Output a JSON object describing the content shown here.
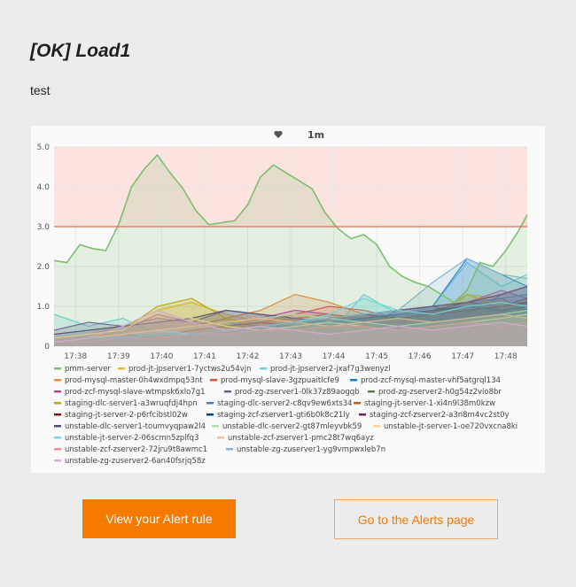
{
  "alert": {
    "title": "[OK] Load1",
    "message": "test"
  },
  "buttons": {
    "view_rule": "View your Alert rule",
    "alerts_page": "Go to the Alerts page"
  },
  "colors": {
    "accent": "#f47a00",
    "threshold": "#f06a50",
    "alert_region": "#fde3e0"
  },
  "chart_data": {
    "type": "area",
    "header_icon": "heart-icon",
    "interval": "1m",
    "threshold": 3.0,
    "ylim": [
      0,
      5.0
    ],
    "yticks": [
      "0",
      "1.0",
      "2.0",
      "3.0",
      "4.0",
      "5.0"
    ],
    "xlim": [
      "17:37:30",
      "17:48:30"
    ],
    "xticks": [
      "17:38",
      "17:39",
      "17:40",
      "17:41",
      "17:42",
      "17:43",
      "17:44",
      "17:45",
      "17:46",
      "17:47",
      "17:48"
    ],
    "grid": true,
    "legend_position": "bottom",
    "series": [
      {
        "name": "pmm-server",
        "color": "#7cbf6e",
        "x": [
          "17:37:30",
          "17:37:48",
          "17:38:06",
          "17:38:24",
          "17:38:42",
          "17:39:00",
          "17:39:18",
          "17:39:36",
          "17:39:54",
          "17:40:12",
          "17:40:30",
          "17:40:48",
          "17:41:06",
          "17:41:24",
          "17:41:42",
          "17:42:00",
          "17:42:18",
          "17:42:36",
          "17:42:54",
          "17:43:12",
          "17:43:30",
          "17:43:48",
          "17:44:06",
          "17:44:24",
          "17:44:42",
          "17:45:00",
          "17:45:18",
          "17:45:36",
          "17:45:54",
          "17:46:12",
          "17:46:30",
          "17:46:48",
          "17:47:06",
          "17:47:24",
          "17:47:42",
          "17:48:00",
          "17:48:18",
          "17:48:30"
        ],
        "values": [
          2.15,
          2.1,
          2.55,
          2.45,
          2.4,
          3.05,
          4.0,
          4.45,
          4.8,
          4.35,
          3.95,
          3.4,
          3.05,
          3.1,
          3.15,
          3.55,
          4.25,
          4.55,
          4.35,
          4.15,
          3.95,
          3.35,
          2.95,
          2.7,
          2.8,
          2.55,
          2.0,
          1.75,
          1.6,
          1.5,
          1.3,
          1.1,
          1.4,
          2.1,
          2.0,
          2.4,
          2.9,
          3.3
        ]
      },
      {
        "name": "prod-jt-jpserver1-7yctws2u54vjn",
        "color": "#f2b62c",
        "x": [
          "17:37:30",
          "17:38:18",
          "17:39:06",
          "17:39:54",
          "17:40:42",
          "17:41:30",
          "17:42:18",
          "17:43:06",
          "17:43:54",
          "17:44:42",
          "17:45:30",
          "17:46:18",
          "17:47:06",
          "17:47:54",
          "17:48:30"
        ],
        "values": [
          0.2,
          0.3,
          0.5,
          0.9,
          1.1,
          0.8,
          0.6,
          0.5,
          0.4,
          0.3,
          0.5,
          0.6,
          1.3,
          1.2,
          0.9
        ]
      },
      {
        "name": "prod-jt-jpserver2-jxaf7g3wenyzl",
        "color": "#6ed0e0",
        "x": [
          "17:37:30",
          "17:38:18",
          "17:39:06",
          "17:39:54",
          "17:40:42",
          "17:41:30",
          "17:42:18",
          "17:43:06",
          "17:43:54",
          "17:44:42",
          "17:45:30",
          "17:46:18",
          "17:47:06",
          "17:47:54",
          "17:48:30"
        ],
        "values": [
          0.8,
          0.5,
          0.7,
          0.3,
          0.4,
          0.5,
          0.3,
          0.4,
          0.3,
          1.3,
          0.8,
          1.0,
          2.1,
          1.5,
          1.8
        ]
      },
      {
        "name": "prod-mysql-master-0h4wxdmpq53nt",
        "color": "#ef843c",
        "x": [
          "17:37:30",
          "17:38:18",
          "17:39:06",
          "17:39:54",
          "17:40:42",
          "17:41:30",
          "17:42:18",
          "17:43:06",
          "17:43:54",
          "17:44:42",
          "17:45:30",
          "17:46:18",
          "17:47:06",
          "17:47:54",
          "17:48:30"
        ],
        "values": [
          0.1,
          0.2,
          0.3,
          0.4,
          0.5,
          0.7,
          0.9,
          1.3,
          1.1,
          0.8,
          0.6,
          0.7,
          0.9,
          1.1,
          1.0
        ]
      },
      {
        "name": "prod-mysql-slave-3gzpuaitlcfe9",
        "color": "#e24d42",
        "x": [
          "17:37:30",
          "17:38:18",
          "17:39:06",
          "17:39:54",
          "17:40:42",
          "17:41:30",
          "17:42:18",
          "17:43:06",
          "17:43:54",
          "17:44:42",
          "17:45:30",
          "17:46:18",
          "17:47:06",
          "17:47:54",
          "17:48:30"
        ],
        "values": [
          0.1,
          0.2,
          0.2,
          0.3,
          0.4,
          0.5,
          0.6,
          0.8,
          1.0,
          0.9,
          0.7,
          0.8,
          1.0,
          1.2,
          0.9
        ]
      },
      {
        "name": "prod-zcf-mysql-master-vhf5atgrql134",
        "color": "#1f78c1",
        "x": [
          "17:37:30",
          "17:38:18",
          "17:39:06",
          "17:39:54",
          "17:40:42",
          "17:41:30",
          "17:42:18",
          "17:43:06",
          "17:43:54",
          "17:44:42",
          "17:45:30",
          "17:46:18",
          "17:47:06",
          "17:47:54",
          "17:48:30"
        ],
        "values": [
          0.1,
          0.1,
          0.2,
          0.2,
          0.3,
          0.4,
          0.5,
          0.6,
          0.7,
          0.8,
          0.9,
          1.0,
          2.2,
          1.8,
          1.5
        ]
      },
      {
        "name": "prod-zcf-mysql-slave-wtmpsk6xlo7g1",
        "color": "#ba43a9",
        "x": [
          "17:37:30",
          "17:38:18",
          "17:39:06",
          "17:39:54",
          "17:40:42",
          "17:41:30",
          "17:42:18",
          "17:43:06",
          "17:43:54",
          "17:44:42",
          "17:45:30",
          "17:46:18",
          "17:47:06",
          "17:47:54",
          "17:48:30"
        ],
        "values": [
          0.2,
          0.3,
          0.4,
          0.8,
          0.6,
          0.5,
          0.7,
          0.9,
          0.8,
          0.7,
          0.6,
          0.9,
          1.1,
          1.4,
          1.2
        ]
      },
      {
        "name": "prod-zg-zserver1-0lk37z89aogqb",
        "color": "#705da0",
        "x": [
          "17:37:30",
          "17:38:18",
          "17:39:06",
          "17:39:54",
          "17:40:42",
          "17:41:30",
          "17:42:18",
          "17:43:06",
          "17:43:54",
          "17:44:42",
          "17:45:30",
          "17:46:18",
          "17:47:06",
          "17:47:54",
          "17:48:30"
        ],
        "values": [
          0.4,
          0.6,
          0.5,
          0.7,
          0.6,
          0.9,
          0.8,
          0.7,
          0.6,
          0.5,
          0.9,
          1.0,
          0.8,
          1.3,
          1.5
        ]
      },
      {
        "name": "prod-zg-zserver2-h0g54z2vio8br",
        "color": "#508642",
        "x": [
          "17:37:30",
          "17:38:18",
          "17:39:06",
          "17:39:54",
          "17:40:42",
          "17:41:30",
          "17:42:18",
          "17:43:06",
          "17:43:54",
          "17:44:42",
          "17:45:30",
          "17:46:18",
          "17:47:06",
          "17:47:54",
          "17:48:30"
        ],
        "values": [
          0.1,
          0.2,
          0.3,
          0.3,
          0.4,
          0.5,
          0.4,
          0.5,
          0.6,
          0.7,
          0.8,
          0.9,
          1.0,
          1.1,
          1.0
        ]
      },
      {
        "name": "staging-dlc-server1-a3wruqfdj4hpn",
        "color": "#cca300",
        "x": [
          "17:37:30",
          "17:38:18",
          "17:39:06",
          "17:39:54",
          "17:40:42",
          "17:41:30",
          "17:42:18",
          "17:43:06",
          "17:43:54",
          "17:44:42",
          "17:45:30",
          "17:46:18",
          "17:47:06",
          "17:47:54",
          "17:48:30"
        ],
        "values": [
          0.1,
          0.2,
          0.4,
          1.0,
          1.2,
          0.7,
          0.5,
          0.4,
          0.5,
          0.6,
          0.7,
          0.8,
          1.3,
          1.0,
          0.8
        ]
      },
      {
        "name": "staging-dlc-server2-c8qv9ew6xts34",
        "color": "#447ebc",
        "x": [
          "17:37:30",
          "17:38:18",
          "17:39:06",
          "17:39:54",
          "17:40:42",
          "17:41:30",
          "17:42:18",
          "17:43:06",
          "17:43:54",
          "17:44:42",
          "17:45:30",
          "17:46:18",
          "17:47:06",
          "17:47:54",
          "17:48:30"
        ],
        "values": [
          0.1,
          0.2,
          0.3,
          0.4,
          0.5,
          0.6,
          0.5,
          0.6,
          0.7,
          0.8,
          0.9,
          1.0,
          1.1,
          1.2,
          1.3
        ]
      },
      {
        "name": "staging-jt-server-1-xi4n9l38m0kzw",
        "color": "#c15c17",
        "x": [
          "17:37:30",
          "17:38:18",
          "17:39:06",
          "17:39:54",
          "17:40:42",
          "17:41:30",
          "17:42:18",
          "17:43:06",
          "17:43:54",
          "17:44:42",
          "17:45:30",
          "17:46:18",
          "17:47:06",
          "17:47:54",
          "17:48:30"
        ],
        "values": [
          0.1,
          0.1,
          0.2,
          0.3,
          0.4,
          0.5,
          0.6,
          0.7,
          0.8,
          0.7,
          0.8,
          0.9,
          1.0,
          1.1,
          1.0
        ]
      },
      {
        "name": "staging-jt-server-2-p6rfcibstl02w",
        "color": "#890f02",
        "x": [
          "17:37:30",
          "17:38:18",
          "17:39:06",
          "17:39:54",
          "17:40:42",
          "17:41:30",
          "17:42:18",
          "17:43:06",
          "17:43:54",
          "17:44:42",
          "17:45:30",
          "17:46:18",
          "17:47:06",
          "17:47:54",
          "17:48:30"
        ],
        "values": [
          0.1,
          0.2,
          0.2,
          0.3,
          0.3,
          0.4,
          0.5,
          0.6,
          0.7,
          0.8,
          0.7,
          0.8,
          0.9,
          1.0,
          1.1
        ]
      },
      {
        "name": "staging-zcf-zserver1-gti6b0k8c21ly",
        "color": "#0a437c",
        "x": [
          "17:37:30",
          "17:38:18",
          "17:39:06",
          "17:39:54",
          "17:40:42",
          "17:41:30",
          "17:42:18",
          "17:43:06",
          "17:43:54",
          "17:44:42",
          "17:45:30",
          "17:46:18",
          "17:47:06",
          "17:47:54",
          "17:48:30"
        ],
        "values": [
          0.1,
          0.1,
          0.2,
          0.2,
          0.3,
          0.4,
          0.5,
          0.5,
          0.6,
          0.7,
          0.8,
          0.9,
          1.0,
          0.9,
          1.0
        ]
      },
      {
        "name": "staging-zcf-zserver2-a3n8m4vc2st0y",
        "color": "#6d1f62",
        "x": [
          "17:37:30",
          "17:38:18",
          "17:39:06",
          "17:39:54",
          "17:40:42",
          "17:41:30",
          "17:42:18",
          "17:43:06",
          "17:43:54",
          "17:44:42",
          "17:45:30",
          "17:46:18",
          "17:47:06",
          "17:47:54",
          "17:48:30"
        ],
        "values": [
          0.1,
          0.2,
          0.3,
          0.2,
          0.4,
          0.5,
          0.6,
          0.5,
          0.7,
          0.8,
          0.9,
          1.0,
          1.1,
          1.3,
          1.5
        ]
      },
      {
        "name": "unstable-dlc-server1-toumvyqpaw2l4",
        "color": "#584477",
        "x": [
          "17:37:30",
          "17:38:18",
          "17:39:06",
          "17:39:54",
          "17:40:42",
          "17:41:30",
          "17:42:18",
          "17:43:06",
          "17:43:54",
          "17:44:42",
          "17:45:30",
          "17:46:18",
          "17:47:06",
          "17:47:54",
          "17:48:30"
        ],
        "values": [
          0.3,
          0.4,
          0.5,
          0.6,
          0.7,
          0.9,
          0.8,
          0.7,
          0.6,
          0.5,
          0.8,
          0.9,
          1.1,
          1.0,
          1.2
        ]
      },
      {
        "name": "unstable-dlc-server2-gt87mleyvbk59",
        "color": "#b7dbab",
        "x": [
          "17:37:30",
          "17:38:18",
          "17:39:06",
          "17:39:54",
          "17:40:42",
          "17:41:30",
          "17:42:18",
          "17:43:06",
          "17:43:54",
          "17:44:42",
          "17:45:30",
          "17:46:18",
          "17:47:06",
          "17:47:54",
          "17:48:30"
        ],
        "values": [
          0.1,
          0.2,
          0.3,
          0.4,
          0.5,
          0.6,
          0.7,
          0.8,
          0.7,
          0.6,
          0.5,
          0.6,
          0.7,
          0.8,
          0.9
        ]
      },
      {
        "name": "unstable-jt-server-1-oe720vxcna8ki",
        "color": "#f4d598",
        "x": [
          "17:37:30",
          "17:38:18",
          "17:39:06",
          "17:39:54",
          "17:40:42",
          "17:41:30",
          "17:42:18",
          "17:43:06",
          "17:43:54",
          "17:44:42",
          "17:45:30",
          "17:46:18",
          "17:47:06",
          "17:47:54",
          "17:48:30"
        ],
        "values": [
          0.2,
          0.3,
          0.4,
          0.9,
          0.7,
          0.5,
          0.4,
          0.5,
          0.6,
          0.5,
          0.4,
          0.5,
          0.6,
          0.7,
          0.8
        ]
      },
      {
        "name": "unstable-jt-server-2-06scmn5zplfq3",
        "color": "#70dbed",
        "x": [
          "17:37:30",
          "17:38:18",
          "17:39:06",
          "17:39:54",
          "17:40:42",
          "17:41:30",
          "17:42:18",
          "17:43:06",
          "17:43:54",
          "17:44:42",
          "17:45:30",
          "17:46:18",
          "17:47:06",
          "17:47:54",
          "17:48:30"
        ],
        "values": [
          0.1,
          0.2,
          0.3,
          0.4,
          0.3,
          0.4,
          0.5,
          0.6,
          0.8,
          1.2,
          0.9,
          0.8,
          1.0,
          1.1,
          1.0
        ]
      },
      {
        "name": "unstable-zcf-zserver1-pmc28t7wq6ayz",
        "color": "#f9ba8f",
        "x": [
          "17:37:30",
          "17:38:18",
          "17:39:06",
          "17:39:54",
          "17:40:42",
          "17:41:30",
          "17:42:18",
          "17:43:06",
          "17:43:54",
          "17:44:42",
          "17:45:30",
          "17:46:18",
          "17:47:06",
          "17:47:54",
          "17:48:30"
        ],
        "values": [
          0.1,
          0.2,
          0.3,
          0.4,
          0.5,
          0.6,
          0.7,
          0.6,
          0.5,
          0.6,
          0.7,
          0.6,
          0.7,
          0.8,
          0.7
        ]
      },
      {
        "name": "unstable-zcf-zserver2-72jru9t8awmc1",
        "color": "#f29191",
        "x": [
          "17:37:30",
          "17:38:18",
          "17:39:06",
          "17:39:54",
          "17:40:42",
          "17:41:30",
          "17:42:18",
          "17:43:06",
          "17:43:54",
          "17:44:42",
          "17:45:30",
          "17:46:18",
          "17:47:06",
          "17:47:54",
          "17:48:30"
        ],
        "values": [
          0.1,
          0.1,
          0.2,
          0.2,
          0.3,
          0.3,
          0.4,
          0.4,
          0.5,
          0.5,
          0.4,
          0.5,
          0.6,
          0.5,
          0.6
        ]
      },
      {
        "name": "unstable-zg-zuserver1-yg9vmpwxleb7n",
        "color": "#82b5d8",
        "x": [
          "17:37:30",
          "17:38:18",
          "17:39:06",
          "17:39:54",
          "17:40:42",
          "17:41:30",
          "17:42:18",
          "17:43:06",
          "17:43:54",
          "17:44:42",
          "17:45:30",
          "17:46:18",
          "17:47:06",
          "17:47:54",
          "17:48:30"
        ],
        "values": [
          0.1,
          0.2,
          0.2,
          0.3,
          0.3,
          0.4,
          0.5,
          0.6,
          0.7,
          0.8,
          0.9,
          1.6,
          2.2,
          1.8,
          1.7
        ]
      },
      {
        "name": "unstable-zg-zuserver2-6an40fsrjq58z",
        "color": "#e5a8e2",
        "x": [
          "17:37:30",
          "17:38:18",
          "17:39:06",
          "17:39:54",
          "17:40:42",
          "17:41:30",
          "17:42:18",
          "17:43:06",
          "17:43:54",
          "17:44:42",
          "17:45:30",
          "17:46:18",
          "17:47:06",
          "17:47:54",
          "17:48:30"
        ],
        "values": [
          0.1,
          0.2,
          0.5,
          0.9,
          0.6,
          0.4,
          0.5,
          0.4,
          0.3,
          0.4,
          0.5,
          0.4,
          0.5,
          0.6,
          0.5
        ]
      }
    ]
  }
}
